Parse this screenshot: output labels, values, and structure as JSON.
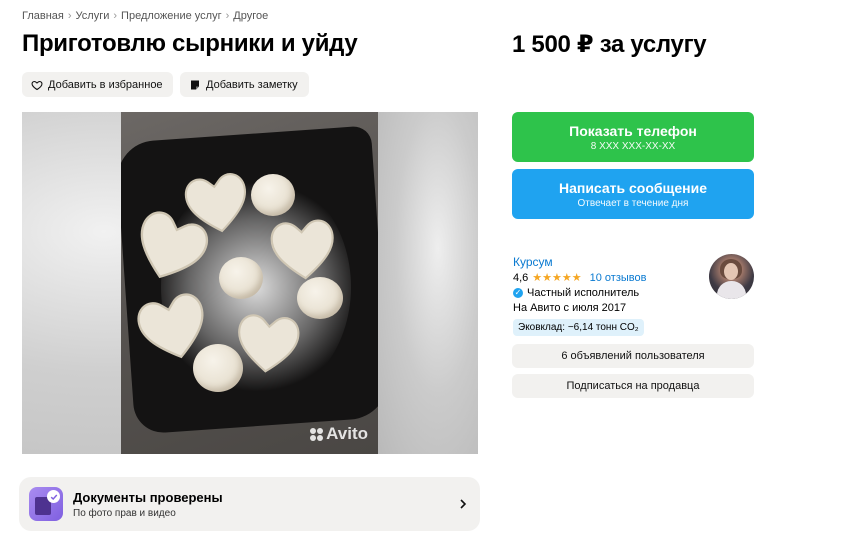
{
  "breadcrumbs": [
    "Главная",
    "Услуги",
    "Предложение услуг",
    "Другое"
  ],
  "title": "Приготовлю сырники и уйду",
  "price": "1 500 ₽ за услугу",
  "actions": {
    "favorite_label": "Добавить в избранное",
    "note_label": "Добавить заметку"
  },
  "gallery": {
    "watermark": "Avito"
  },
  "docs": {
    "title": "Документы проверены",
    "subtitle": "По фото прав и видео"
  },
  "contact": {
    "phone_label": "Показать телефон",
    "phone_masked": "8 XXX XXX-XX-XX",
    "message_label": "Написать сообщение",
    "message_sub": "Отвечает в течение дня"
  },
  "seller": {
    "name": "Курсум",
    "rating": "4,6",
    "reviews": "10 отзывов",
    "type": "Частный исполнитель",
    "since": "На Авито с июля 2017",
    "eco": "Эковклад: −6,14 тонн CO₂",
    "ads_button": "6 объявлений пользователя",
    "subscribe_button": "Подписаться на продавца"
  },
  "colors": {
    "green": "#2ec34b",
    "blue": "#1fa3f0",
    "link": "#0a7ad1",
    "star": "#f5a623"
  }
}
